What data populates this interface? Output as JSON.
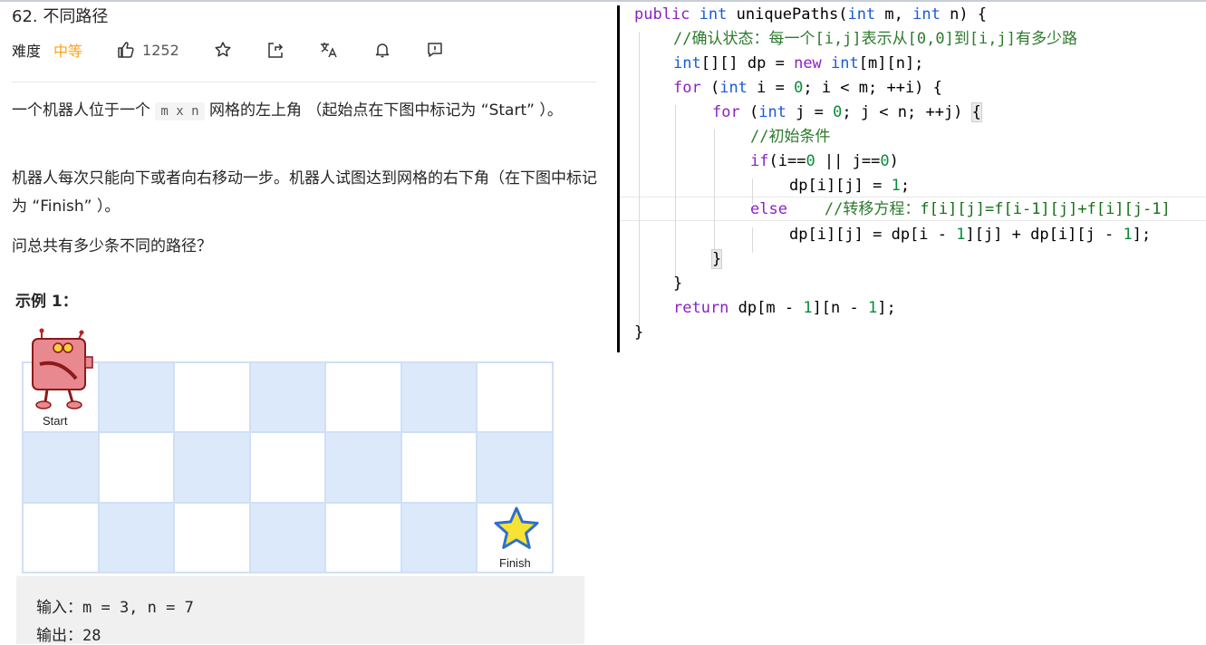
{
  "problem": {
    "title": "62. 不同路径",
    "difficulty_label": "难度",
    "difficulty": "中等",
    "likes": "1252",
    "desc1_a": "一个机器人位于一个",
    "desc1_code": "m x n",
    "desc1_b": "网格的左上角 （起始点在下图中标记为 “Start” ）。",
    "desc2": "机器人每次只能向下或者向右移动一步。机器人试图达到网格的右下角（在下图中标记为 “Finish” ）。",
    "desc3": "问总共有多少条不同的路径？",
    "example_title": "示例 1：",
    "start_label": "Start",
    "finish_label": "Finish",
    "input_line": "输入：m = 3, n = 7",
    "output_line": "输出：28"
  },
  "icons": [
    "thumbs-up-icon",
    "star-icon",
    "share-icon",
    "translate-icon",
    "bell-icon",
    "feedback-icon"
  ],
  "colors": {
    "accent": "#ffa116",
    "grid_blue": "#dce9fb",
    "keyword": "#8b22c4",
    "type": "#1a5ad8",
    "number": "#0a8a3a",
    "comment": "#2d7a2d"
  },
  "code": {
    "l1": {
      "a": "public",
      "b": " ",
      "c": "int",
      "d": " uniquePaths(",
      "e": "int",
      "f": " m, ",
      "g": "int",
      "h": " n) {"
    },
    "l2": "//确认状态：每一个[i,j]表示从[0,0]到[i,j]有多少路",
    "l3": {
      "a": "int",
      "b": "[][] dp = ",
      "c": "new",
      "d": " ",
      "e": "int",
      "f": "[m][n];"
    },
    "l4": {
      "a": "for",
      "b": " (",
      "c": "int",
      "d": " i = ",
      "e": "0",
      "f": "; i < m; ++i) {"
    },
    "l5": {
      "a": "for",
      "b": " (",
      "c": "int",
      "d": " j = ",
      "e": "0",
      "f": "; j < n; ++j) ",
      "g": "{"
    },
    "l6": "//初始条件",
    "l7": {
      "a": "if",
      "b": "(i==",
      "c": "0",
      "d": " || j==",
      "e": "0",
      "f": ")"
    },
    "l8": {
      "a": "dp[i][j] = ",
      "b": "1",
      "c": ";"
    },
    "l9": {
      "a": "else",
      "b": "    //转移方程：",
      "c": "f[i][j]=f[i-1][j]+f[i][j-1]"
    },
    "l10": {
      "a": "dp[i][j] = dp[i - ",
      "b": "1",
      "c": "][j] + dp[i][j - ",
      "d": "1",
      "e": "];"
    },
    "l11": "}",
    "l12": "}",
    "l13": {
      "a": "return",
      "b": " dp[m - ",
      "c": "1",
      "d": "][n - ",
      "e": "1",
      "f": "];"
    },
    "l14": "}"
  }
}
